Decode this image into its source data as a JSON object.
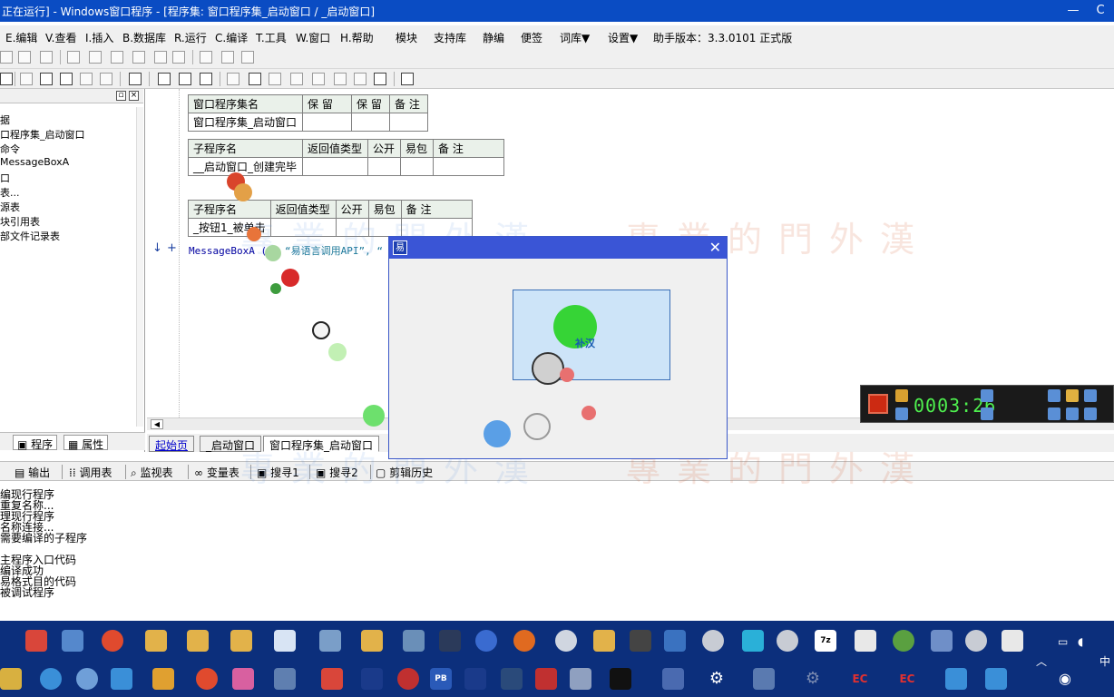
{
  "window": {
    "title": "正在运行] - Windows窗口程序 - [程序集: 窗口程序集_启动窗口 / _启动窗口]",
    "ctrl_icon": "C"
  },
  "menubar": {
    "items": [
      "E.编辑",
      "V.查看",
      "I.插入",
      "B.数据库",
      "R.运行",
      "C.编译",
      "T.工具",
      "W.窗口",
      "H.帮助",
      "模块",
      "支持库",
      "静编",
      "便签",
      "词库▼",
      "设置▼"
    ],
    "version": "助手版本：3.3.0101 正式版"
  },
  "left_panel": {
    "tree_items": [
      "据",
      "口程序集_启动窗口",
      "命令",
      "MessageBoxA",
      "口",
      "表...",
      "源表",
      "块引用表",
      "部文件记录表"
    ],
    "tabs": [
      "程序",
      "属性"
    ]
  },
  "editor": {
    "assembly_table": {
      "headers": [
        "窗口程序集名",
        "保 留",
        "保 留",
        "备 注"
      ],
      "row": [
        "窗口程序集_启动窗口",
        "",
        "",
        ""
      ]
    },
    "sub_table_1": {
      "headers": [
        "子程序名",
        "返回值类型",
        "公开",
        "易包",
        "备 注"
      ],
      "row": [
        "__启动窗口_创建完毕",
        "",
        "",
        "",
        ""
      ]
    },
    "sub_table_2": {
      "headers": [
        "子程序名",
        "返回值类型",
        "公开",
        "易包",
        "备 注"
      ],
      "row": [
        "_按钮1_被单击",
        "",
        "",
        "",
        ""
      ]
    },
    "code_line": {
      "call": "MessageBoxA (0, ",
      "string": "“易语言调用API”",
      "rest": ", “"
    },
    "markers": [
      "↓",
      "+"
    ]
  },
  "doc_tabs": [
    "起始页",
    "_启动窗口",
    "窗口程序集_启动窗口"
  ],
  "output_tabs": [
    "输出",
    "调用表",
    "监视表",
    "变量表",
    "搜寻1",
    "搜寻2",
    "剪辑历史"
  ],
  "output_lines": [
    "编现行程序",
    "重复名称...",
    "理现行程序",
    "名称连接...",
    "需要编译的子程序",
    "",
    "主程序入口代码",
    "编译成功",
    "易格式目的代码",
    "被调试程序"
  ],
  "demo_window": {
    "caption": "补汉"
  },
  "recorder": {
    "time": "0003:26"
  },
  "watermark": "專業的門外漢",
  "taskbar": {
    "ime": "中",
    "row1_labels": [
      "7z",
      "EC",
      "PB"
    ]
  }
}
